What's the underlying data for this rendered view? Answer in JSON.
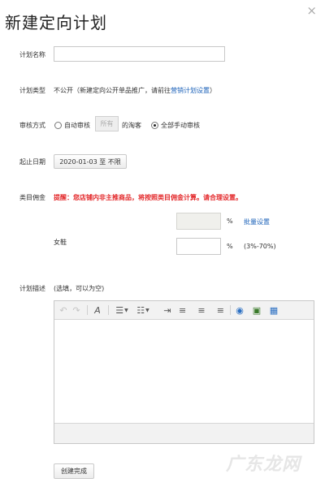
{
  "dialog": {
    "title": "新建定向计划",
    "close_symbol": "×"
  },
  "plan_name": {
    "label": "计划名称",
    "value": ""
  },
  "plan_type": {
    "label": "计划类型",
    "text_before": "不公开（新建定向公开单品推广，请前往",
    "link": "营销计划设置",
    "text_after": "）"
  },
  "audit": {
    "label": "审核方式",
    "auto_option": "自动审核",
    "select_value": "所有",
    "suffix": "的淘客",
    "manual_option": "全部手动审核",
    "selected": "manual"
  },
  "dates": {
    "label": "起止日期",
    "button": "2020-01-03 至 不限"
  },
  "commission": {
    "label": "类目佣金",
    "warning": "提醒：您店铺内非主推商品，将按照类目佣金计算。请合理设置。",
    "batch_value": "",
    "percent": "%",
    "batch_link": "批量设置",
    "category_name": "女鞋",
    "category_value": "",
    "range": "(3%-70%)"
  },
  "description": {
    "label": "计划描述",
    "hint": "(选填，可以为空)",
    "content": "",
    "toolbar": {
      "undo": "↶",
      "redo": "↷",
      "format": "A",
      "bullet": "☰",
      "numbered": "☷",
      "indent": "⇥",
      "align_left": "≡",
      "align_center": "≡",
      "align_right": "≡",
      "link": "◉",
      "image": "▣",
      "table": "▦",
      "caret": "▼"
    }
  },
  "submit": {
    "label": "创建完成"
  },
  "watermark": "广东龙网"
}
